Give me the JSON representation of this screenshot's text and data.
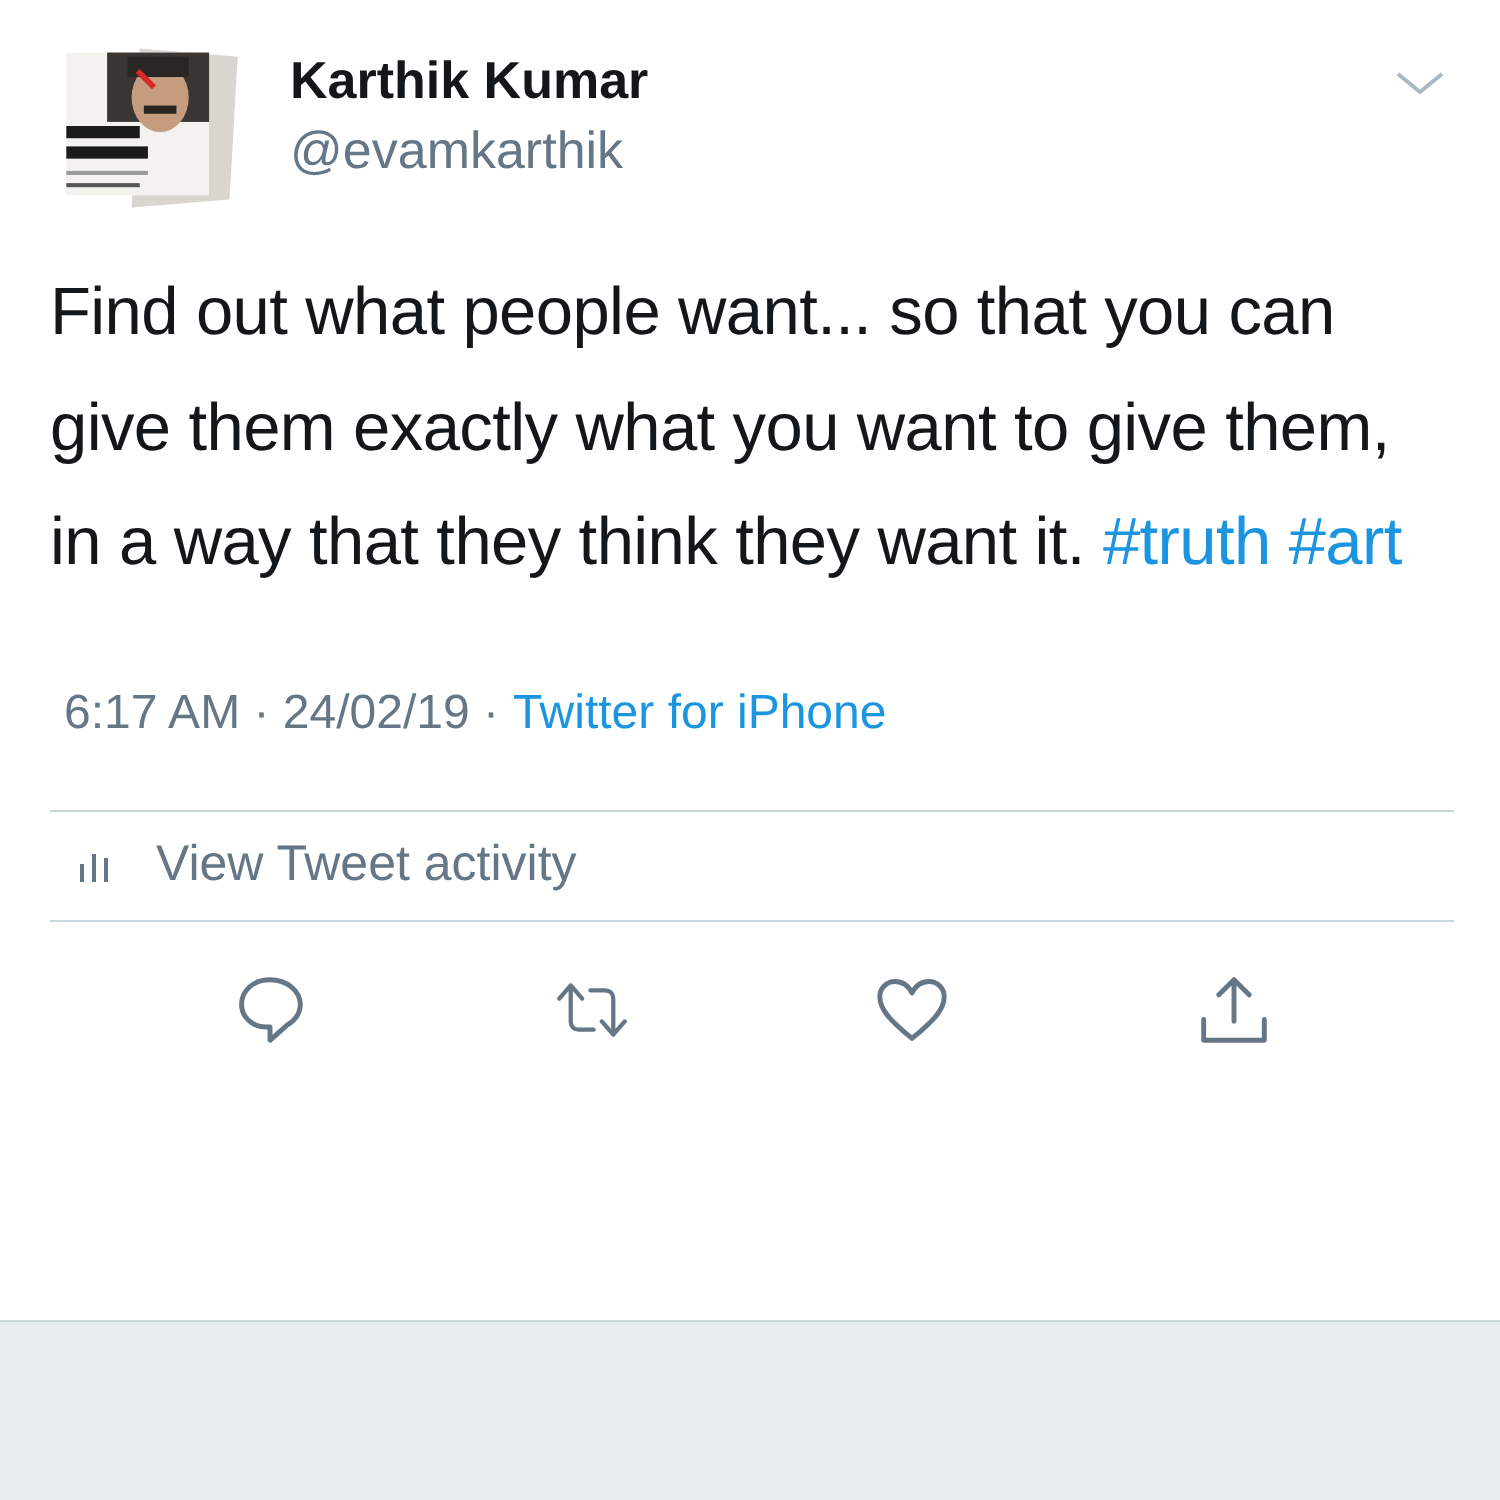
{
  "author": {
    "name": "Karthik Kumar",
    "handle": "@evamkarthik"
  },
  "tweet": {
    "text": "Find out what people want... so that you can give them exactly what you want to give them, in a way that they think they want it.",
    "hashtags": [
      "#truth",
      "#art"
    ]
  },
  "meta": {
    "text": "6:17 AM · 24/02/19 ·",
    "source": "Twitter for iPhone"
  },
  "activity": {
    "label": "View Tweet activity"
  },
  "actions": [
    {
      "kind": "reply"
    },
    {
      "kind": "retweet"
    },
    {
      "kind": "like"
    },
    {
      "kind": "share"
    }
  ]
}
